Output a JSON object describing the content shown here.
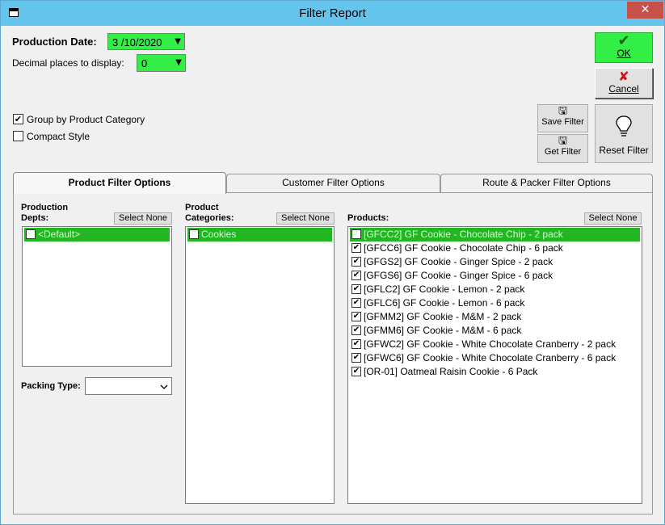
{
  "window": {
    "title": "Filter Report",
    "close_label": "✕"
  },
  "header": {
    "production_date_label": "Production Date:",
    "production_date_value": "3 /10/2020",
    "decimal_label": "Decimal places to display:",
    "decimal_value": "0"
  },
  "options": {
    "group_by_label": "Group by Product Category",
    "group_by_checked": true,
    "compact_label": "Compact Style",
    "compact_checked": false
  },
  "buttons": {
    "ok_label": "OK",
    "cancel_label": "Cancel",
    "save_filter_label": "Save Filter",
    "get_filter_label": "Get Filter",
    "reset_filter_label": "Reset Filter"
  },
  "tabs": [
    {
      "label": "Product Filter Options",
      "active": true
    },
    {
      "label": "Customer Filter Options",
      "active": false
    },
    {
      "label": "Route & Packer Filter Options",
      "active": false
    }
  ],
  "product_filter": {
    "depts_label_line1": "Production",
    "depts_label_line2": "Depts:",
    "categories_label_line1": "Product",
    "categories_label_line2": "Categories:",
    "products_label": "Products:",
    "select_none_label": "Select None",
    "packing_type_label": "Packing Type:",
    "packing_type_value": "",
    "depts": [
      "<Default>"
    ],
    "categories": [
      "Cookies"
    ],
    "products": [
      "[GFCC2] GF Cookie - Chocolate Chip - 2 pack",
      "[GFCC6] GF Cookie - Chocolate Chip - 6 pack",
      "[GFGS2] GF Cookie - Ginger Spice - 2 pack",
      "[GFGS6] GF Cookie - Ginger Spice - 6 pack",
      "[GFLC2] GF Cookie - Lemon - 2 pack",
      "[GFLC6] GF Cookie - Lemon - 6 pack",
      "[GFMM2] GF Cookie - M&M - 2 pack",
      "[GFMM6] GF Cookie - M&M - 6 pack",
      "[GFWC2] GF Cookie - White Chocolate Cranberry - 2 pack",
      "[GFWC6] GF Cookie - White Chocolate Cranberry - 6 pack",
      "[OR-01] Oatmeal Raisin Cookie - 6 Pack"
    ]
  },
  "colors": {
    "accent_green": "#33ee44",
    "selection_green": "#22b722",
    "titlebar": "#65c4ec"
  }
}
